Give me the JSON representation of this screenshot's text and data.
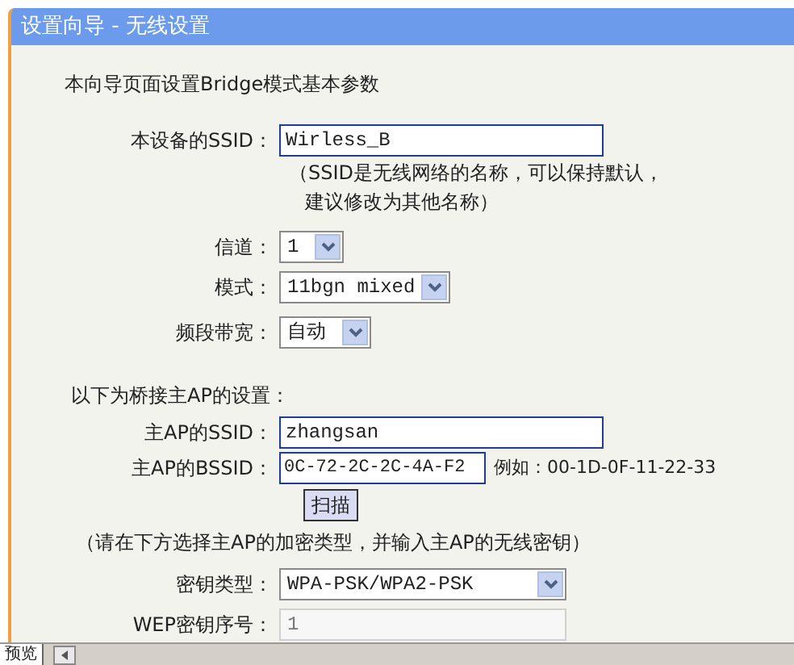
{
  "header": {
    "title": "设置向导 - 无线设置"
  },
  "intro": "本向导页面设置Bridge模式基本参数",
  "ssid": {
    "label": "本设备的SSID：",
    "value": "Wirless_B",
    "hint": [
      "（SSID是无线网络的名称，可以保持默认，",
      "建议修改为其他名称）"
    ]
  },
  "selects": [
    {
      "label": "信道：",
      "value": "1"
    },
    {
      "label": "模式：",
      "value": "11bgn mixed"
    },
    {
      "label": "频段带宽：",
      "value": "自动"
    }
  ],
  "section": "以下为桥接主AP的设置：",
  "ap_ssid": {
    "label": "主AP的SSID：",
    "value": "zhangsan"
  },
  "ap_bssid": {
    "label": "主AP的BSSID：",
    "value": "0C-72-2C-2C-4A-F2",
    "example": "例如：00-1D-0F-11-22-33"
  },
  "scan_button": "扫描",
  "note": "（请在下方选择主AP的加密类型，并输入主AP的无线密钥）",
  "key_type": {
    "label": "密钥类型：",
    "value": "WPA-PSK/WPA2-PSK"
  },
  "wep_index": {
    "label": "WEP密钥序号：",
    "value": "1",
    "disabled": true
  },
  "bottom_tab": "预览"
}
